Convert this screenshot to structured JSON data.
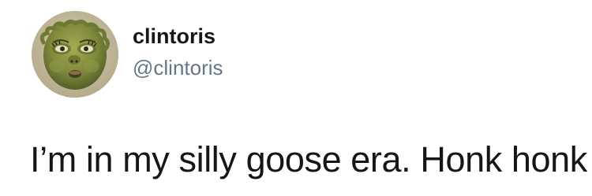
{
  "tweet": {
    "author": {
      "display_name": "clintoris",
      "handle": "@clintoris",
      "avatar_icon": "grinch-face-avatar"
    },
    "text": "I’m in my silly goose era. Honk honk"
  },
  "colors": {
    "text_primary": "#14171a",
    "text_secondary": "#657786",
    "background": "#ffffff"
  }
}
